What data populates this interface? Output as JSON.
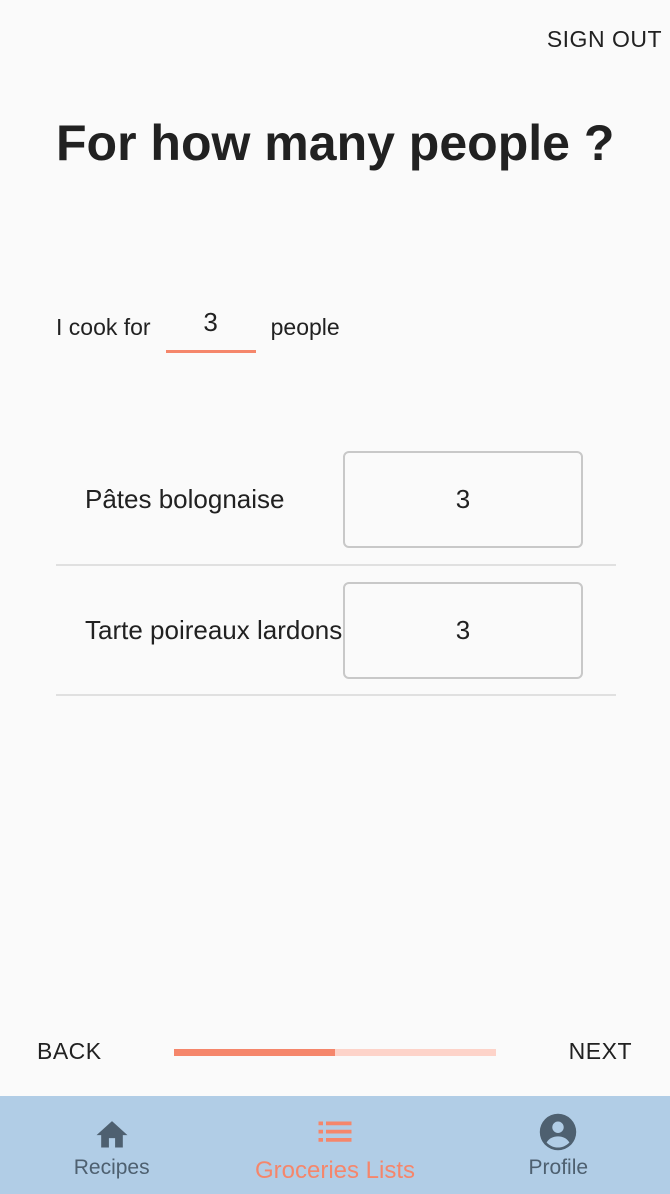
{
  "header": {
    "sign_out_label": "SIGN OUT"
  },
  "page": {
    "title": "For how many people ?"
  },
  "cook_for": {
    "prefix": "I cook for",
    "value": "3",
    "suffix": "people"
  },
  "recipes": [
    {
      "name": "Pâtes bolognaise",
      "servings": "3"
    },
    {
      "name": "Tarte poireaux lardons",
      "servings": "3"
    }
  ],
  "wizard": {
    "back_label": "BACK",
    "next_label": "NEXT",
    "progress": 0.5
  },
  "bottom_nav": {
    "active_color": "#f5866b",
    "inactive_color": "#4e6070",
    "background": "#b1cde6",
    "items": [
      {
        "label": "Recipes",
        "icon": "home-icon",
        "active": false
      },
      {
        "label": "Groceries Lists",
        "icon": "list-icon",
        "active": true
      },
      {
        "label": "Profile",
        "icon": "account-circle-icon",
        "active": false
      }
    ]
  }
}
